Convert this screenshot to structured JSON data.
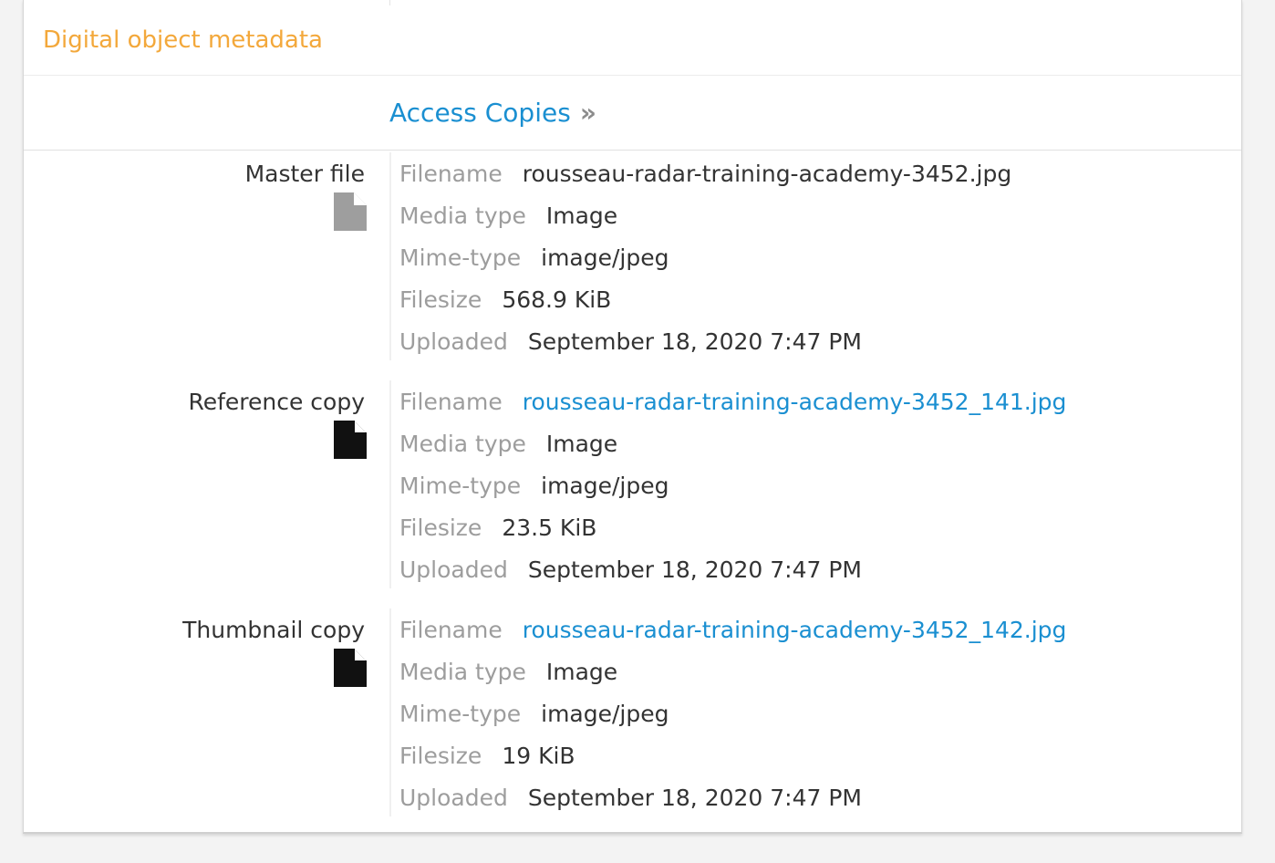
{
  "section": {
    "title": "Digital object metadata"
  },
  "access": {
    "label": "Access Copies",
    "chevron": "»"
  },
  "labels": {
    "filename": "Filename",
    "media_type": "Media type",
    "mime_type": "Mime-type",
    "filesize": "Filesize",
    "uploaded": "Uploaded"
  },
  "groups": [
    {
      "title": "Master file",
      "icon": "file-icon",
      "icon_color": "#9e9e9e",
      "filename": "rousseau-radar-training-academy-3452.jpg",
      "filename_is_link": false,
      "media_type": "Image",
      "mime_type": "image/jpeg",
      "filesize": "568.9 KiB",
      "uploaded": "September 18, 2020 7:47 PM"
    },
    {
      "title": "Reference copy",
      "icon": "file-icon",
      "icon_color": "#111111",
      "filename": "rousseau-radar-training-academy-3452_141.jpg",
      "filename_is_link": true,
      "media_type": "Image",
      "mime_type": "image/jpeg",
      "filesize": "23.5 KiB",
      "uploaded": "September 18, 2020 7:47 PM"
    },
    {
      "title": "Thumbnail copy",
      "icon": "file-icon",
      "icon_color": "#111111",
      "filename": "rousseau-radar-training-academy-3452_142.jpg",
      "filename_is_link": true,
      "media_type": "Image",
      "mime_type": "image/jpeg",
      "filesize": "19 KiB",
      "uploaded": "September 18, 2020 7:47 PM"
    }
  ],
  "colors": {
    "accent_orange": "#f3a83b",
    "link_blue": "#1a8fd1",
    "label_gray": "#9d9d9d",
    "text_dark": "#333333"
  }
}
